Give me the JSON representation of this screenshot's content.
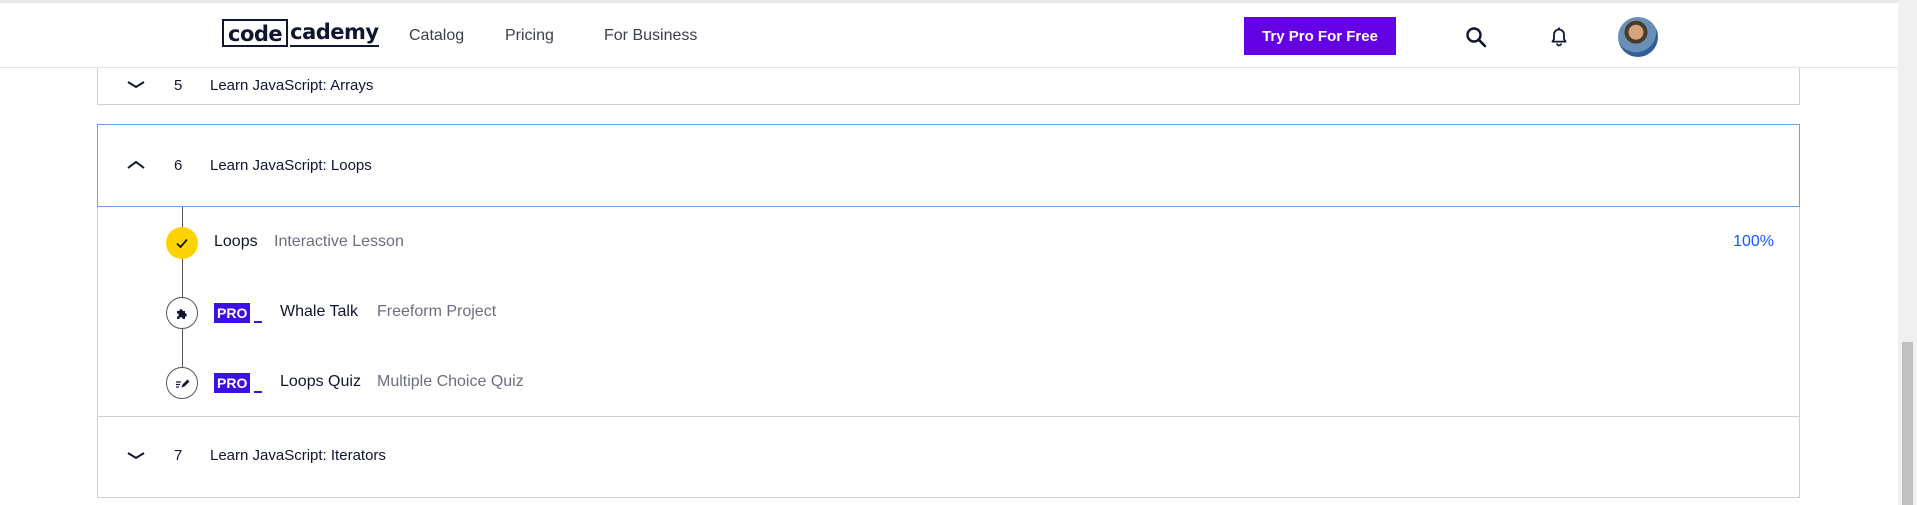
{
  "header": {
    "logo_left": "code",
    "logo_right": "cademy",
    "nav": [
      {
        "label": "Catalog"
      },
      {
        "label": "Pricing"
      },
      {
        "label": "For Business"
      }
    ],
    "cta_label": "Try Pro For Free",
    "icons": [
      "search-icon",
      "bell-icon"
    ]
  },
  "syllabus": {
    "modules": [
      {
        "number": "5",
        "title": "Learn JavaScript: Arrays",
        "expanded": false
      },
      {
        "number": "6",
        "title": "Learn JavaScript: Loops",
        "expanded": true
      },
      {
        "number": "7",
        "title": "Learn JavaScript: Iterators",
        "expanded": false
      }
    ],
    "lessons": [
      {
        "name": "Loops",
        "type": "Interactive Lesson",
        "progress": "100%",
        "status": "completed",
        "pro": false
      },
      {
        "name": "Whale Talk",
        "type": "Freeform Project",
        "status": "not-started",
        "pro": true,
        "pro_label": "PRO",
        "icon": "puzzle-icon"
      },
      {
        "name": "Loops Quiz",
        "type": "Multiple Choice Quiz",
        "status": "not-started",
        "pro": true,
        "pro_label": "PRO",
        "icon": "quiz-pencil-icon"
      }
    ]
  },
  "colors": {
    "brand_purple": "#6400e4",
    "pro_badge": "#3a10e5",
    "complete_yellow": "#ffd300",
    "progress_blue": "#1557ff",
    "selected_border": "#6aa2e6"
  }
}
